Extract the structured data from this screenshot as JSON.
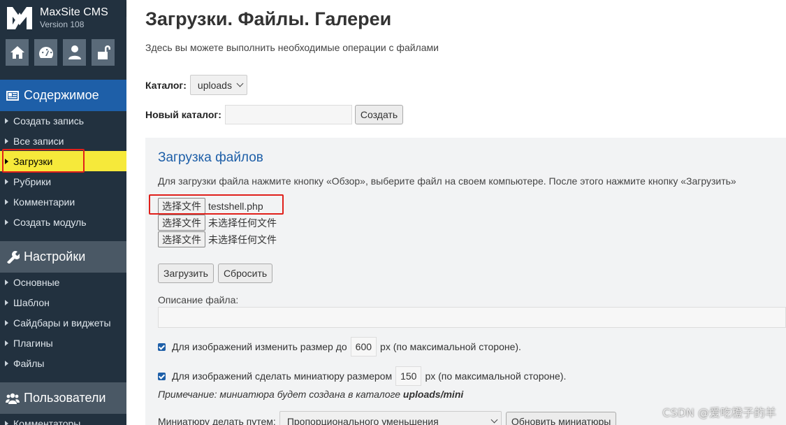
{
  "brand": {
    "name": "MaxSite CMS",
    "version": "Version 108"
  },
  "quick_icons": [
    "home-icon",
    "dashboard-icon",
    "user-icon",
    "unlock-icon"
  ],
  "sidebar": {
    "content": {
      "title": "Содержимое",
      "items": [
        {
          "label": "Создать запись"
        },
        {
          "label": "Все записи"
        },
        {
          "label": "Загрузки",
          "active": true
        },
        {
          "label": "Рубрики"
        },
        {
          "label": "Комментарии"
        },
        {
          "label": "Создать модуль"
        }
      ]
    },
    "settings": {
      "title": "Настройки",
      "items": [
        {
          "label": "Основные"
        },
        {
          "label": "Шаблон"
        },
        {
          "label": "Сайдбары и виджеты"
        },
        {
          "label": "Плагины"
        },
        {
          "label": "Файлы"
        }
      ]
    },
    "users": {
      "title": "Пользователи",
      "items": [
        {
          "label": "Комментаторы"
        }
      ]
    }
  },
  "main": {
    "title": "Загрузки. Файлы. Галереи",
    "description": "Здесь вы можете выполнить необходимые операции с файлами",
    "catalog_label": "Каталог:",
    "catalog_value": "uploads",
    "new_catalog_label": "Новый каталог:",
    "new_catalog_value": "",
    "create_button": "Создать"
  },
  "upload": {
    "title": "Загрузка файлов",
    "help": "Для загрузки файла нажмите кнопку «Обзор», выберите файл на своем компьютере. После этого нажмите кнопку «Загрузить»",
    "file_button": "选择文件",
    "files": [
      "testshell.php",
      "未选择任何文件",
      "未选择任何文件"
    ],
    "upload_button": "Загрузить",
    "reset_button": "Сбросить",
    "file_desc_label": "Описание файла:",
    "file_desc_value": "",
    "resize_label": "Для изображений изменить размер до",
    "resize_value": "600",
    "resize_suffix": "px (по максимальной стороне).",
    "thumb_label": "Для изображений сделать миниатюру размером",
    "thumb_value": "150",
    "thumb_suffix": "px (по максимальной стороне).",
    "note_prefix": "Примечание: миниатюра будет создана в каталоге ",
    "note_path": "uploads/mini",
    "method_label": "Миниатюру делать путем:",
    "method_value": "Пропорционального уменьшения",
    "refresh_button": "Обновить миниатюры"
  },
  "watermark": "CSDN @爱吃橙子的羊",
  "colors": {
    "sidebar_bg": "#22313f",
    "accent": "#1e5fa8",
    "active_item": "#f6e93a",
    "highlight": "#e0201b"
  }
}
